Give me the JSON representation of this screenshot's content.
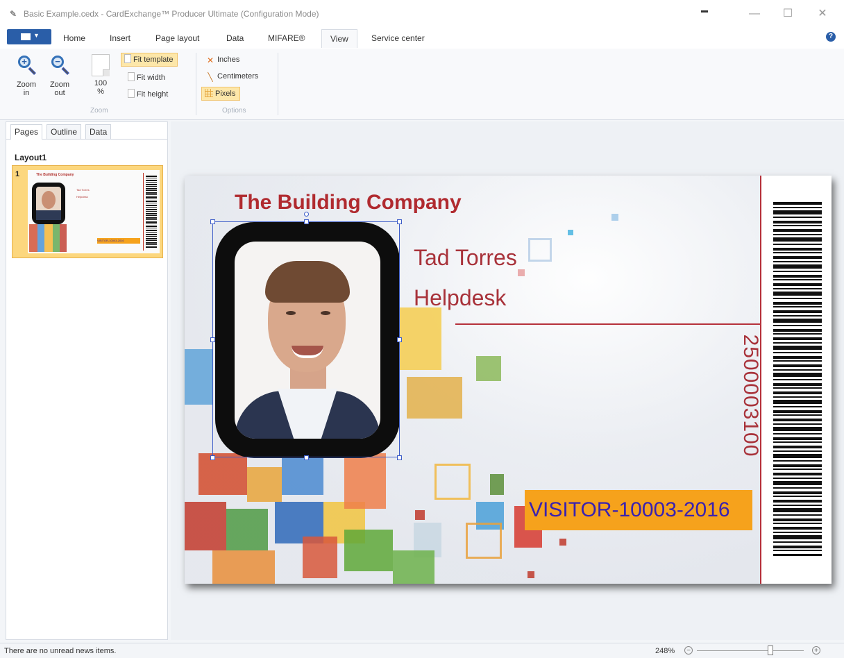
{
  "window": {
    "title": "Basic Example.cedx - CardExchange™ Producer Ultimate (Configuration Mode)",
    "minimize": "—",
    "maximize": "☐",
    "close": "✕"
  },
  "ribbon": {
    "tabs": [
      "Home",
      "Insert",
      "Page layout",
      "Data",
      "MIFARE®",
      "View",
      "Service center"
    ],
    "active_tab": "View",
    "zoom_group": {
      "label": "Zoom",
      "zoom_in": "Zoom in",
      "zoom_out": "Zoom out",
      "hundred": "100 %",
      "fit_template": "Fit template",
      "fit_width": "Fit width",
      "fit_height": "Fit height"
    },
    "options_group": {
      "label": "Options",
      "inches": "Inches",
      "centimeters": "Centimeters",
      "pixels": "Pixels",
      "selected": "Pixels"
    },
    "help": "?"
  },
  "left_panel": {
    "tabs": [
      "Pages",
      "Outline",
      "Data"
    ],
    "active_tab": "Pages",
    "layout_name": "Layout1",
    "page_number": "1"
  },
  "card": {
    "company": "The Building Company",
    "name": "Tad Torres",
    "role": "Helpdesk",
    "number": "2500003100",
    "visitor_id": "VISITOR-10003-2016",
    "colors": {
      "accent_red": "#b02a2f",
      "visitor_bg": "#f6a21c",
      "visitor_text": "#3a22b0"
    }
  },
  "statusbar": {
    "message": "There are no unread news items.",
    "zoom": "248%"
  },
  "icons": [
    "app-icon",
    "zoom-in-icon",
    "zoom-out-icon",
    "page-icon",
    "inches-icon",
    "centimeters-icon",
    "pixels-icon",
    "help-icon",
    "zoom-minus-icon",
    "zoom-plus-icon"
  ]
}
